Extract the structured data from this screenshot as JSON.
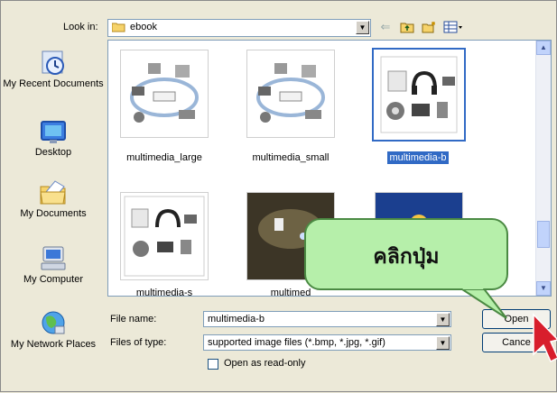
{
  "look_in": {
    "label": "Look in:",
    "value": "ebook"
  },
  "places": [
    {
      "label": "My Recent Documents",
      "icon": "recent-documents-icon"
    },
    {
      "label": "Desktop",
      "icon": "desktop-icon"
    },
    {
      "label": "My Documents",
      "icon": "my-documents-icon"
    },
    {
      "label": "My Computer",
      "icon": "my-computer-icon"
    },
    {
      "label": "My Network Places",
      "icon": "network-places-icon"
    }
  ],
  "files": [
    {
      "name": "multimedia_large",
      "selected": false
    },
    {
      "name": "multimedia_small",
      "selected": false
    },
    {
      "name": "multimedia-b",
      "selected": true
    },
    {
      "name": "multimedia-s",
      "selected": false
    },
    {
      "name": "multimed",
      "selected": false
    },
    {
      "name": "",
      "selected": false
    }
  ],
  "file_name": {
    "label": "File name:",
    "value": "multimedia-b"
  },
  "file_type": {
    "label": "Files of type:",
    "value": "supported image files (*.bmp, *.jpg, *.gif)"
  },
  "read_only": {
    "label": "Open as read-only",
    "checked": false
  },
  "buttons": {
    "open": "Open",
    "cancel": "Cance"
  },
  "callout": {
    "text": "คลิกปุ่ม"
  },
  "colors": {
    "selection": "#316ac5",
    "callout_fill": "#b6efaa",
    "cursor": "#d81e2c"
  }
}
